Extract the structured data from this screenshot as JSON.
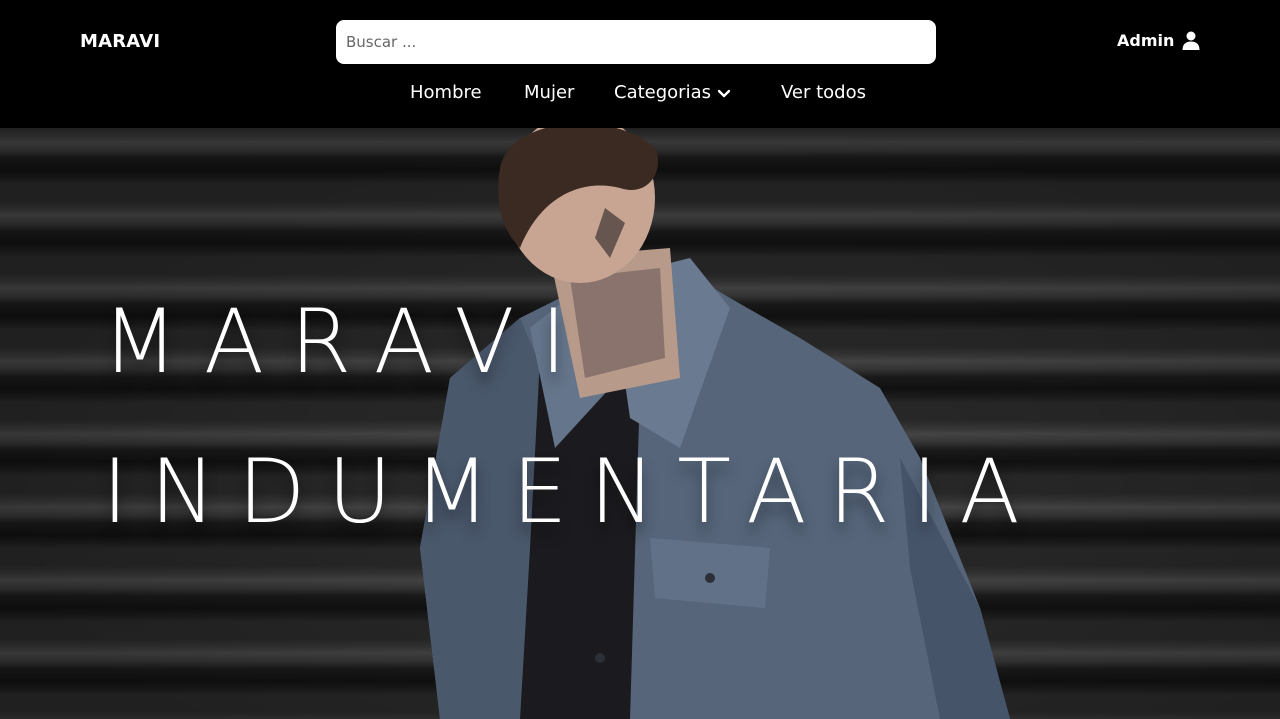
{
  "header": {
    "brand": "MARAVI",
    "search": {
      "placeholder": "Buscar ...",
      "value": ""
    },
    "account": {
      "label": "Admin",
      "icon": "user-icon"
    }
  },
  "nav": {
    "items": [
      {
        "label": "Hombre"
      },
      {
        "label": "Mujer"
      },
      {
        "label": "Categorias",
        "icon": "chevron-down-icon"
      },
      {
        "label": "Ver todos"
      }
    ]
  },
  "hero": {
    "line1": "MARAVI",
    "line2": "INDUMENTARIA"
  },
  "colors": {
    "header_bg": "#000000",
    "text": "#ffffff",
    "denim": "#5a6a80"
  }
}
